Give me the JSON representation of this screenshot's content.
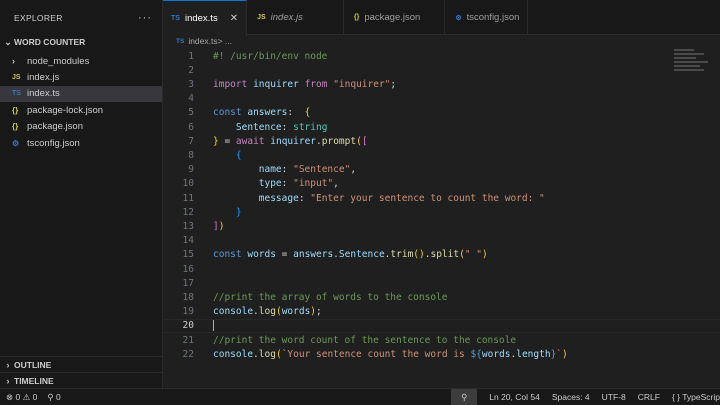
{
  "sidebar": {
    "title": "EXPLORER",
    "more": "···",
    "folder": "WORD COUNTER",
    "items": [
      {
        "label": "node_modules",
        "icon": "folder-icon",
        "glyph": "›"
      },
      {
        "label": "index.js",
        "icon": "js-file-icon",
        "glyph": "JS"
      },
      {
        "label": "index.ts",
        "icon": "ts-file-icon",
        "glyph": "TS",
        "selected": true
      },
      {
        "label": "package-lock.json",
        "icon": "json-file-icon",
        "glyph": "{}"
      },
      {
        "label": "package.json",
        "icon": "json-file-icon",
        "glyph": "{}"
      },
      {
        "label": "tsconfig.json",
        "icon": "tsconfig-file-icon",
        "glyph": "⚙"
      }
    ],
    "outline": "OUTLINE",
    "timeline": "TIMELINE"
  },
  "tabs": [
    {
      "label": "index.ts",
      "glyph": "TS",
      "active": true,
      "close": "✕"
    },
    {
      "label": "index.js",
      "glyph": "JS",
      "italic": true
    },
    {
      "label": "package.json",
      "glyph": "{}"
    },
    {
      "label": "tsconfig.json",
      "glyph": "⚙"
    }
  ],
  "breadcrumb": {
    "glyph": "TS",
    "file": "index.ts",
    "rest": " > ..."
  },
  "editor": {
    "current_line": 20,
    "lines": [
      [
        [
          "com",
          "#! /usr/bin/env node"
        ]
      ],
      [],
      [
        [
          "ctl",
          "import"
        ],
        [
          "plain",
          " "
        ],
        [
          "var",
          "inquirer"
        ],
        [
          "plain",
          " "
        ],
        [
          "ctl",
          "from"
        ],
        [
          "plain",
          " "
        ],
        [
          "str",
          "\"inquirer\""
        ],
        [
          "plain",
          ";"
        ]
      ],
      [],
      [
        [
          "kw",
          "const"
        ],
        [
          "plain",
          " "
        ],
        [
          "var",
          "answers"
        ],
        [
          "plain",
          ":  "
        ],
        [
          "br1",
          "{"
        ]
      ],
      [
        [
          "plain",
          "    "
        ],
        [
          "var",
          "Sentence"
        ],
        [
          "plain",
          ": "
        ],
        [
          "type",
          "string"
        ]
      ],
      [
        [
          "br1",
          "}"
        ],
        [
          "plain",
          " = "
        ],
        [
          "ctl",
          "await"
        ],
        [
          "plain",
          " "
        ],
        [
          "var",
          "inquirer"
        ],
        [
          "plain",
          "."
        ],
        [
          "fn",
          "prompt"
        ],
        [
          "br1",
          "("
        ],
        [
          "br2",
          "["
        ]
      ],
      [
        [
          "plain",
          "    "
        ],
        [
          "br3",
          "{"
        ]
      ],
      [
        [
          "plain",
          "        "
        ],
        [
          "var",
          "name"
        ],
        [
          "plain",
          ": "
        ],
        [
          "str",
          "\"Sentence\""
        ],
        [
          "plain",
          ","
        ]
      ],
      [
        [
          "plain",
          "        "
        ],
        [
          "var",
          "type"
        ],
        [
          "plain",
          ": "
        ],
        [
          "str",
          "\"input\""
        ],
        [
          "plain",
          ","
        ]
      ],
      [
        [
          "plain",
          "        "
        ],
        [
          "var",
          "message"
        ],
        [
          "plain",
          ": "
        ],
        [
          "str",
          "\"Enter your sentence to count the word: \""
        ]
      ],
      [
        [
          "plain",
          "    "
        ],
        [
          "br3",
          "}"
        ]
      ],
      [
        [
          "br2",
          "]"
        ],
        [
          "br1",
          ")"
        ]
      ],
      [],
      [
        [
          "kw",
          "const"
        ],
        [
          "plain",
          " "
        ],
        [
          "var",
          "words"
        ],
        [
          "plain",
          " = "
        ],
        [
          "var",
          "answers"
        ],
        [
          "plain",
          "."
        ],
        [
          "var",
          "Sentence"
        ],
        [
          "plain",
          "."
        ],
        [
          "fn",
          "trim"
        ],
        [
          "br1",
          "()"
        ],
        [
          "plain",
          "."
        ],
        [
          "fn",
          "split"
        ],
        [
          "br1",
          "("
        ],
        [
          "str",
          "\" \""
        ],
        [
          "br1",
          ")"
        ]
      ],
      [],
      [],
      [
        [
          "com",
          "//print the array of words to the console"
        ]
      ],
      [
        [
          "var",
          "console"
        ],
        [
          "plain",
          "."
        ],
        [
          "fn",
          "log"
        ],
        [
          "br1",
          "("
        ],
        [
          "var",
          "words"
        ],
        [
          "br1",
          ")"
        ],
        [
          "plain",
          ";"
        ]
      ],
      [],
      [
        [
          "com",
          "//print the word count of the sentence to the console"
        ]
      ],
      [
        [
          "var",
          "console"
        ],
        [
          "plain",
          "."
        ],
        [
          "fn",
          "log"
        ],
        [
          "br1",
          "("
        ],
        [
          "str",
          "`Your sentence count the word is "
        ],
        [
          "kw",
          "${"
        ],
        [
          "var",
          "words"
        ],
        [
          "plain",
          "."
        ],
        [
          "var",
          "length"
        ],
        [
          "kw",
          "}"
        ],
        [
          "str",
          "`"
        ],
        [
          "br1",
          ")"
        ]
      ]
    ]
  },
  "status": {
    "errors": "0",
    "warnings": "0",
    "ports": "0",
    "cursor": "Ln 20, Col 54",
    "spaces": "Spaces: 4",
    "encoding": "UTF-8",
    "eol": "CRLF",
    "language": "{ } TypeScrip"
  },
  "colors": {
    "accent": "#0078d4",
    "editor_bg": "#1f1f1f",
    "sidebar_bg": "#181818",
    "selected_bg": "#37373d"
  }
}
